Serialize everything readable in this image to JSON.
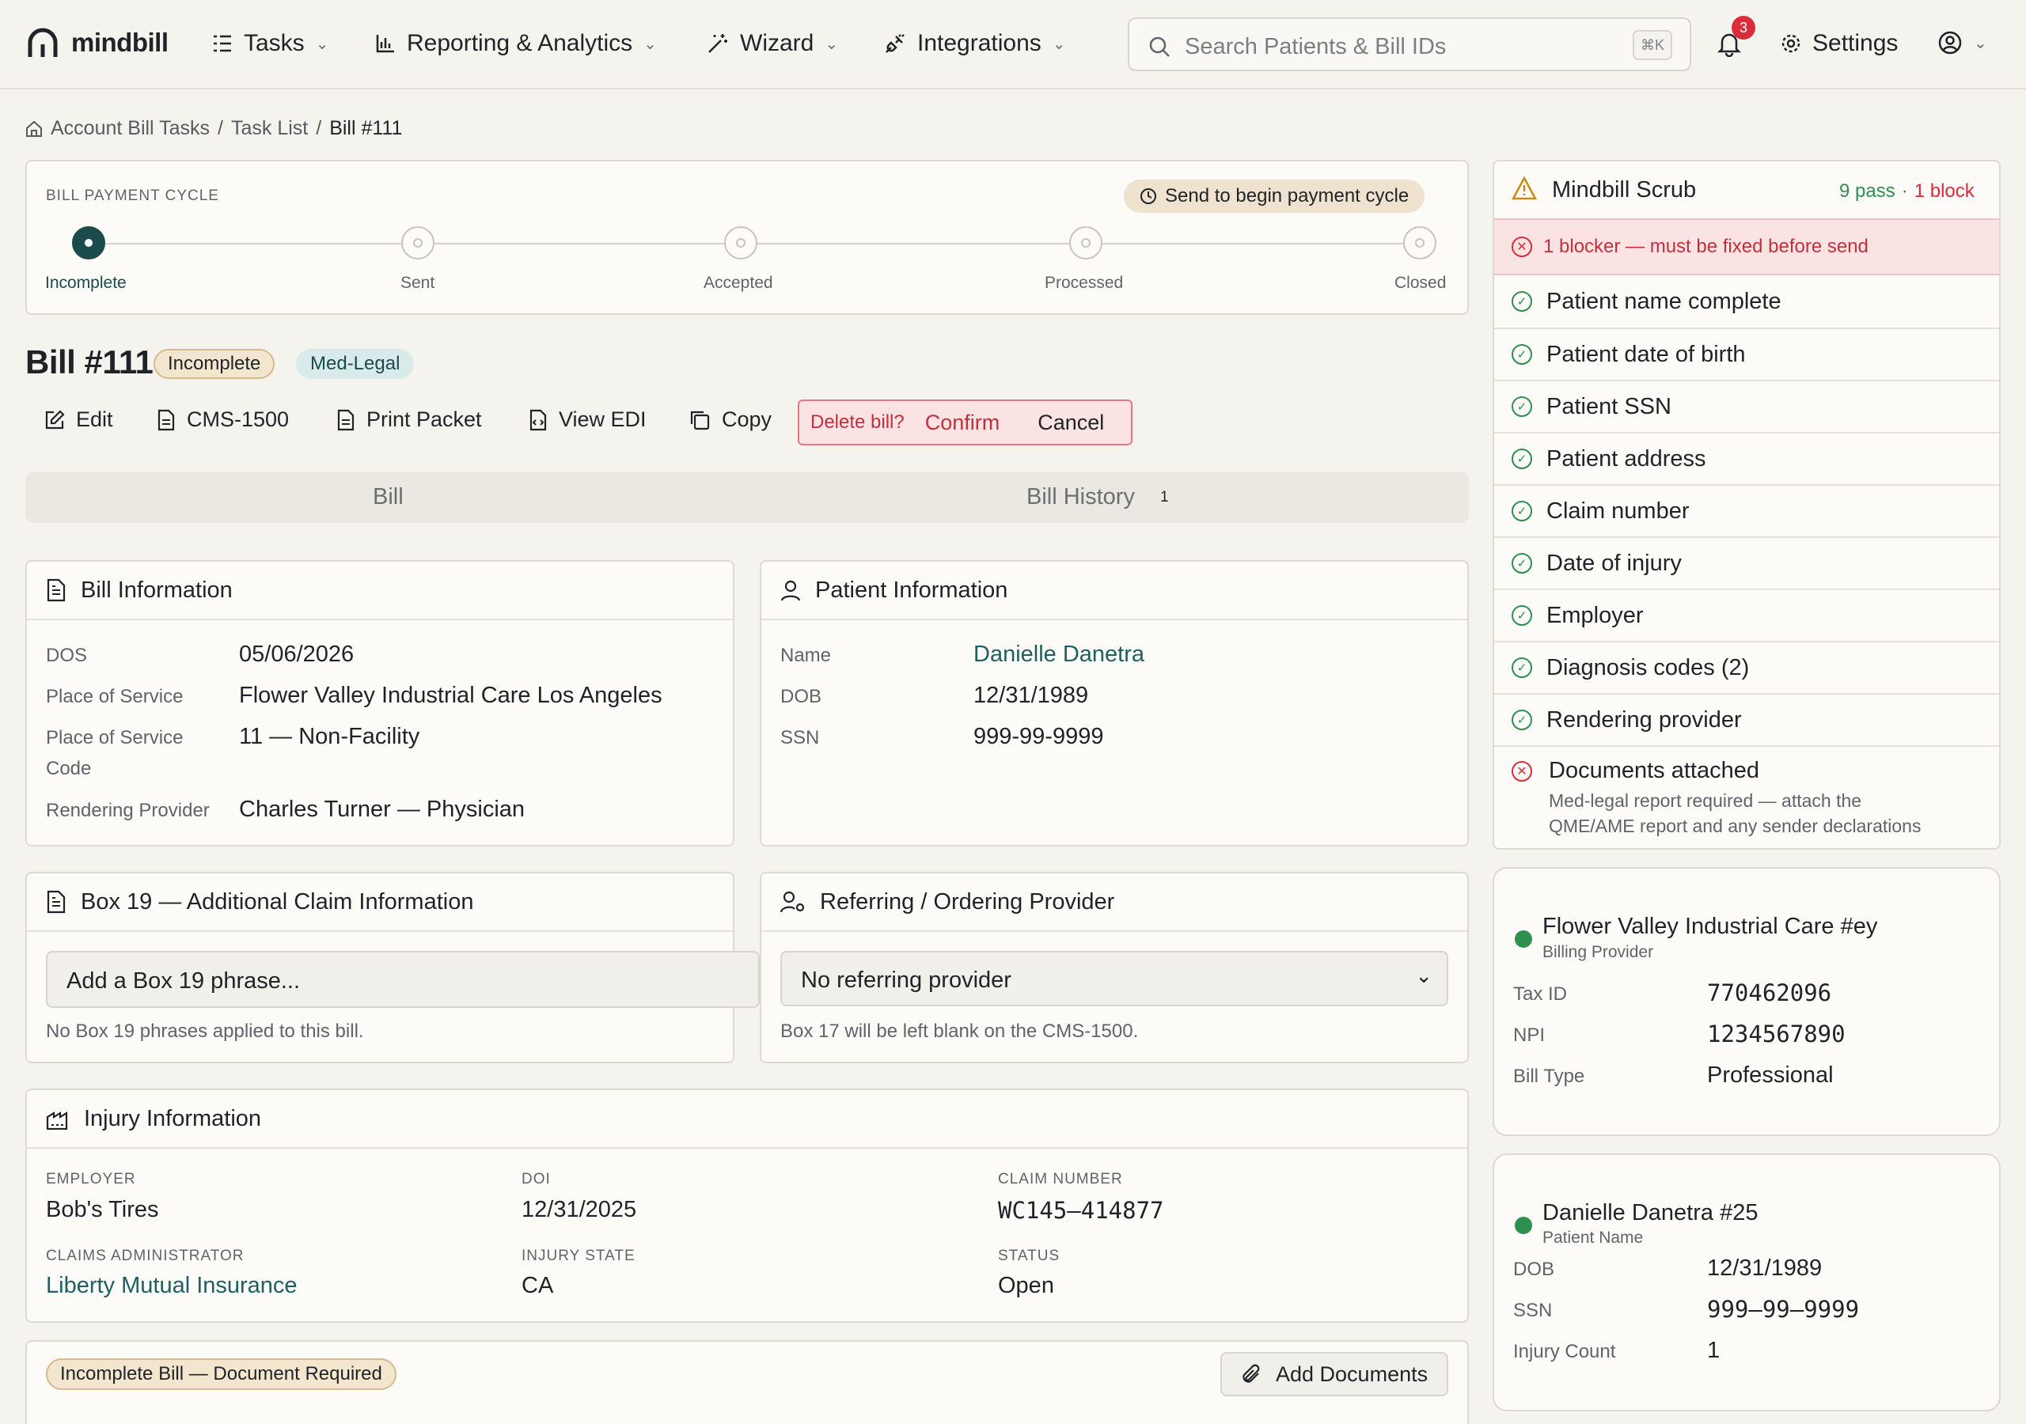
{
  "nav": {
    "brand": "mindbill",
    "items": [
      "Tasks",
      "Reporting & Analytics",
      "Wizard",
      "Integrations"
    ],
    "search_placeholder": "Search Patients & Bill IDs",
    "search_shortcut": "⌘K",
    "notification_count": "3",
    "settings_label": "Settings"
  },
  "breadcrumb": {
    "items": [
      "Account Bill Tasks",
      "Task List"
    ],
    "current": "Bill #111"
  },
  "cycle": {
    "title": "BILL PAYMENT CYCLE",
    "hint": "Send to begin payment cycle",
    "steps": [
      "Incomplete",
      "Sent",
      "Accepted",
      "Processed",
      "Closed"
    ],
    "active_step": 0
  },
  "bill": {
    "title": "Bill #111",
    "status_badge": "Incomplete",
    "type_badge": "Med-Legal",
    "actions": [
      "Edit",
      "CMS-1500",
      "Print Packet",
      "View EDI",
      "Copy"
    ],
    "delete_prompt": "Delete bill?",
    "confirm_label": "Confirm",
    "cancel_label": "Cancel",
    "tabs": [
      "Bill",
      "Bill History"
    ],
    "history_count": "1"
  },
  "bill_info": {
    "title": "Bill Information",
    "dos_label": "DOS",
    "dos": "05/06/2026",
    "pos_label": "Place of Service",
    "pos": "Flower Valley Industrial Care Los Angeles",
    "posc_label_1": "Place of Service",
    "posc_label_2": "Code",
    "posc": "11 — Non-Facility",
    "rp_label": "Rendering Provider",
    "rp": "Charles Turner — Physician"
  },
  "patient_info": {
    "title": "Patient Information",
    "name_label": "Name",
    "name": "Danielle Danetra",
    "dob_label": "DOB",
    "dob": "12/31/1989",
    "ssn_label": "SSN",
    "ssn": "999-99-9999"
  },
  "box19": {
    "title": "Box 19 — Additional Claim Information",
    "placeholder": "Add a Box 19 phrase...",
    "note": "No Box 19 phrases applied to this bill."
  },
  "referring": {
    "title": "Referring / Ordering Provider",
    "selected": "No referring provider",
    "note": "Box 17 will be left blank on the CMS-1500."
  },
  "injury": {
    "title": "Injury Information",
    "employer_label": "EMPLOYER",
    "employer": "Bob's Tires",
    "doi_label": "DOI",
    "doi": "12/31/2025",
    "claim_label": "CLAIM NUMBER",
    "claim": "WC145–414877",
    "admin_label": "CLAIMS ADMINISTRATOR",
    "admin": "Liberty Mutual Insurance",
    "state_label": "INJURY STATE",
    "state": "CA",
    "status_label": "STATUS",
    "status": "Open"
  },
  "documents": {
    "badge": "Incomplete Bill — Document Required",
    "add_label": "Add Documents"
  },
  "scrub": {
    "title": "Mindbill Scrub",
    "pass": "9 pass",
    "sep": "·",
    "block": "1 block",
    "blocker": "1 blocker — must be fixed before send",
    "checks": [
      "Patient name complete",
      "Patient date of birth",
      "Patient SSN",
      "Patient address",
      "Claim number",
      "Date of injury",
      "Employer",
      "Diagnosis codes (2)",
      "Rendering provider"
    ],
    "failed": "Documents attached",
    "failed_detail_1": "Med-legal report required — attach the",
    "failed_detail_2": "QME/AME report and any sender declarations"
  },
  "billing_provider": {
    "name": "Flower Valley Industrial Care #ey",
    "role": "Billing Provider",
    "tax_label": "Tax ID",
    "tax": "770462096",
    "npi_label": "NPI",
    "npi": "1234567890",
    "type_label": "Bill Type",
    "type": "Professional"
  },
  "patient_card": {
    "name": "Danielle Danetra #25",
    "role": "Patient Name",
    "dob_label": "DOB",
    "dob": "12/31/1989",
    "ssn_label": "SSN",
    "ssn": "999–99–9999",
    "injury_label": "Injury Count",
    "injury": "1"
  },
  "colors": {
    "accent": "#1c4b4d",
    "danger": "#d92d3a",
    "success": "#2f8f4e",
    "background": "#f5f3ee"
  }
}
